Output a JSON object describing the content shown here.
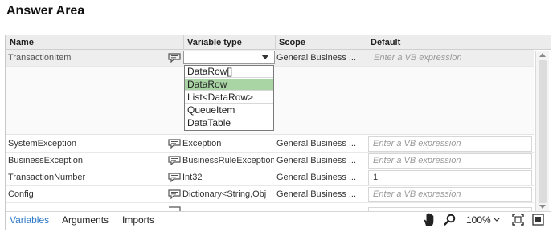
{
  "heading": "Answer Area",
  "columns": [
    "Name",
    "Variable type",
    "Scope",
    "Default"
  ],
  "selected_row": {
    "name": "TransactionItem",
    "scope": "General Business ...",
    "default_placeholder": "Enter a VB expression",
    "type_value": ""
  },
  "type_dropdown": {
    "options": [
      "DataRow[]",
      "DataRow",
      "List<DataRow>",
      "QueueItem",
      "DataTable"
    ],
    "highlighted": "DataRow"
  },
  "rows": [
    {
      "name": "SystemException",
      "type": "Exception",
      "scope": "General Business ...",
      "default": "Enter a VB expression",
      "default_is_placeholder": true
    },
    {
      "name": "BusinessException",
      "type": "BusinessRuleException",
      "scope": "General Business ...",
      "default": "Enter a VB expression",
      "default_is_placeholder": true
    },
    {
      "name": "TransactionNumber",
      "type": "Int32",
      "scope": "General Business ...",
      "default": "1",
      "default_is_placeholder": false
    },
    {
      "name": "Config",
      "type": "Dictionary<String,Obj",
      "scope": "General Business ...",
      "default": "Enter a VB expression",
      "default_is_placeholder": true
    }
  ],
  "footer": {
    "tabs": [
      "Variables",
      "Arguments",
      "Imports"
    ],
    "active_tab": "Variables",
    "zoom": "100%"
  },
  "colors": {
    "accent": "#2d77c7",
    "highlight": "#a9d5a5",
    "header_bg": "#ececec"
  }
}
